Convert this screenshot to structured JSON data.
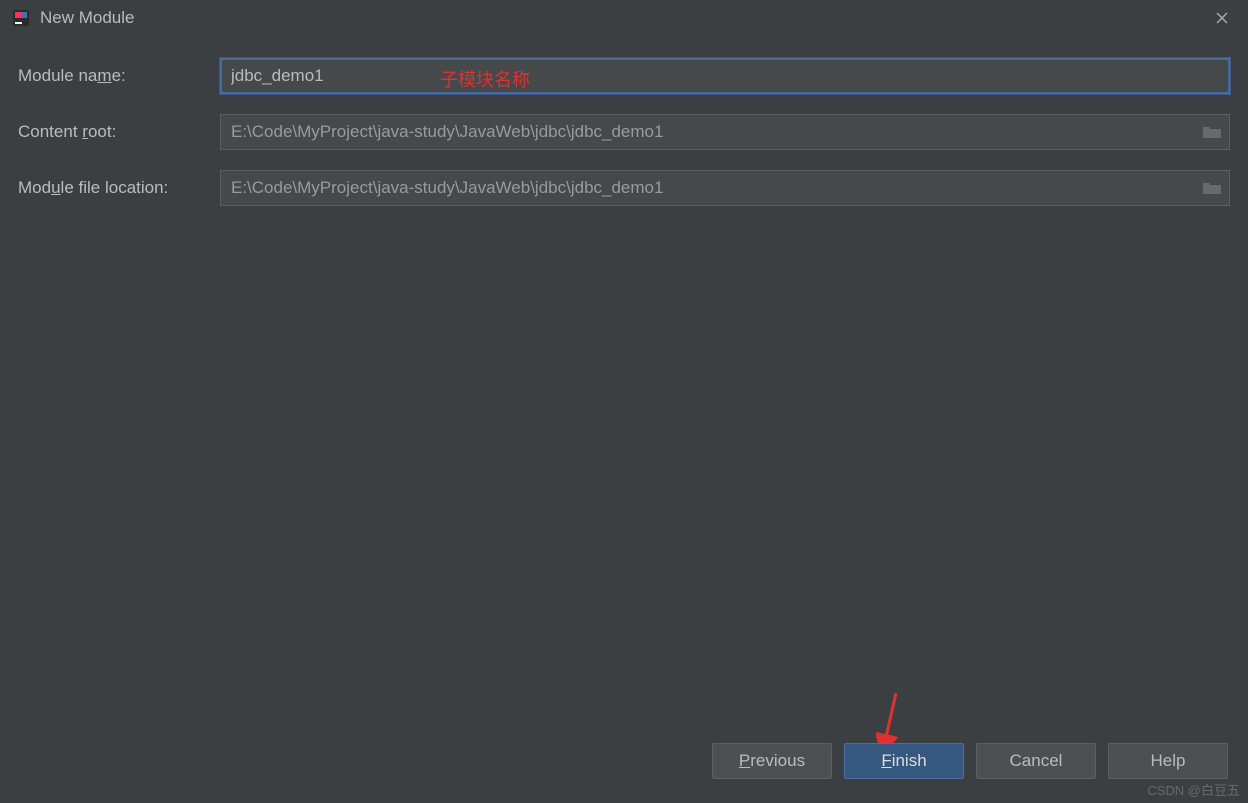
{
  "window": {
    "title": "New Module"
  },
  "form": {
    "module_name_label": "Module name:",
    "module_name_value": "jdbc_demo1",
    "content_root_label": "Content root:",
    "content_root_value": "E:\\Code\\MyProject\\java-study\\JavaWeb\\jdbc\\jdbc_demo1",
    "module_file_location_label": "Module file location:",
    "module_file_location_value": "E:\\Code\\MyProject\\java-study\\JavaWeb\\jdbc\\jdbc_demo1"
  },
  "annotations": {
    "module_name_note": "子模块名称"
  },
  "buttons": {
    "previous": "Previous",
    "finish": "Finish",
    "cancel": "Cancel",
    "help": "Help"
  },
  "watermark": "CSDN @白豆五"
}
